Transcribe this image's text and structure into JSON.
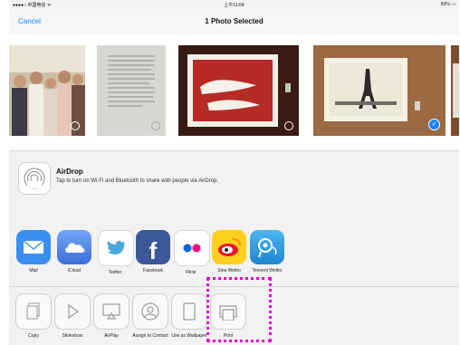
{
  "status": {
    "left": "●●●●○ 中国电信 ᯤ",
    "time": "上午11:04",
    "battery": "83% ▭"
  },
  "nav": {
    "cancel": "Cancel",
    "title": "1 Photo Selected"
  },
  "airdrop": {
    "title": "AirDrop",
    "desc": "Tap to turn on Wi-Fi and Bluetooth to share with people via AirDrop."
  },
  "apps": [
    {
      "label": "Mail",
      "color": "#3b8ff1",
      "icon": "mail-icon"
    },
    {
      "label": "iCloud",
      "color": "#4f7fe6",
      "icon": "cloud-icon"
    },
    {
      "label": "Twitter",
      "color": "#ffffff",
      "icon": "twitter-bird-icon"
    },
    {
      "label": "Facebook",
      "color": "#3b5998",
      "icon": "facebook-icon"
    },
    {
      "label": "Flickr",
      "color": "#ffffff",
      "icon": "flickr-icon"
    },
    {
      "label": "Sina Weibo",
      "color": "#ffd100",
      "icon": "weibo-icon"
    },
    {
      "label": "Tencent Weibo",
      "color": "#3a9ad9",
      "icon": "tencent-weibo-icon"
    }
  ],
  "actions": [
    {
      "label": "Copy",
      "icon": "copy-icon"
    },
    {
      "label": "Slideshow",
      "icon": "play-icon"
    },
    {
      "label": "AirPlay",
      "icon": "airplay-icon"
    },
    {
      "label": "Assign to Contact",
      "icon": "contact-icon"
    },
    {
      "label": "Use as Wallpaper",
      "icon": "wallpaper-icon"
    },
    {
      "label": "Print",
      "icon": "print-icon"
    }
  ],
  "photos": [
    {
      "name": "group-photo",
      "selected": false
    },
    {
      "name": "document-photo",
      "selected": false
    },
    {
      "name": "red-painting-photo",
      "selected": false
    },
    {
      "name": "eiffel-tower-print-photo",
      "selected": true
    }
  ],
  "highlight_color": "#e400d8"
}
